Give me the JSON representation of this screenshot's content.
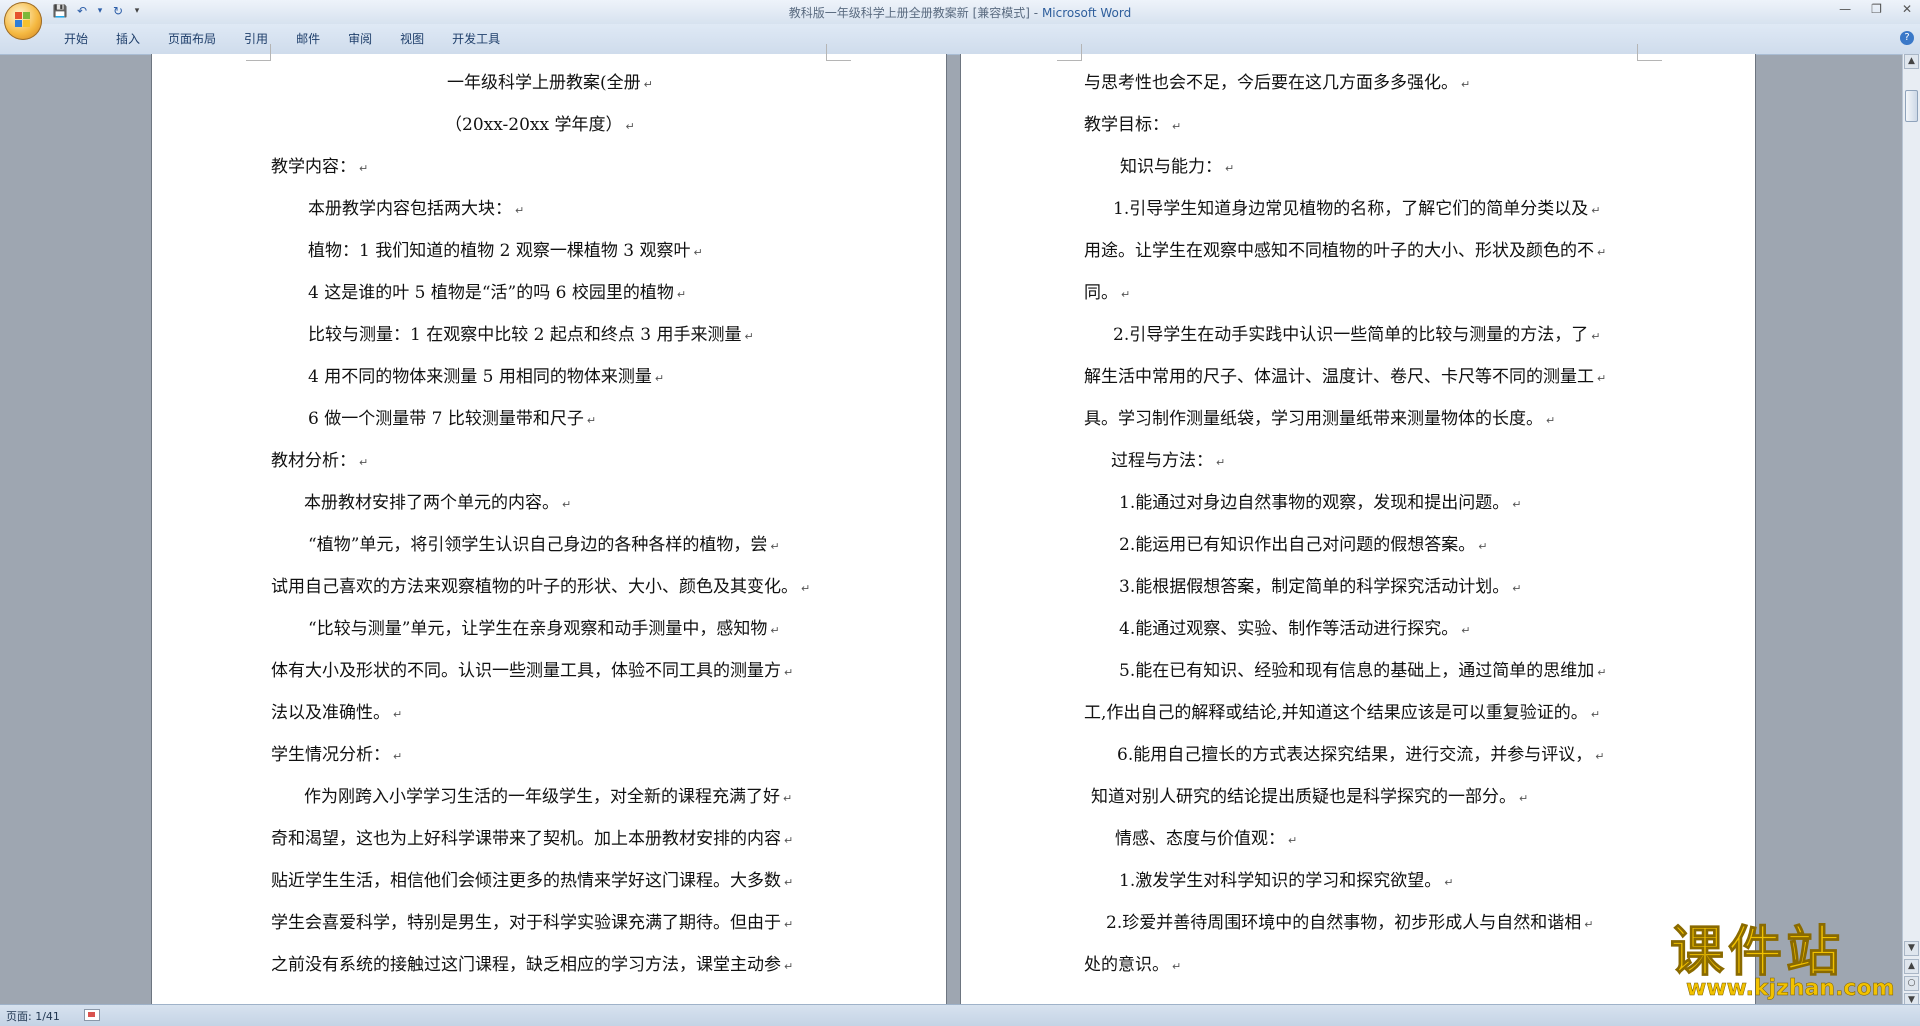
{
  "window": {
    "title_doc": "教科版一年级科学上册全册教案新 [兼容模式]",
    "title_sep": " - ",
    "title_app": "Microsoft Word",
    "help_glyph": "?"
  },
  "qat": {
    "save": "💾",
    "undo": "↶",
    "undo_dropdown": "▾",
    "redo": "↻",
    "customize": "▾"
  },
  "window_controls": {
    "minimize": "—",
    "restore": "❐",
    "close": "✕"
  },
  "ribbon": {
    "tabs": [
      "开始",
      "插入",
      "页面布局",
      "引用",
      "邮件",
      "审阅",
      "视图",
      "开发工具"
    ]
  },
  "page1": {
    "lines": [
      "一年级科学上册教案(全册",
      "（20xx-20xx 学年度）",
      "教学内容：",
      "本册教学内容包括两大块：",
      "植物：1 我们知道的植物   2 观察一棵植物   3 观察叶",
      "4 这是谁的叶   5 植物是“活”的吗   6 校园里的植物",
      "比较与测量：1 在观察中比较   2 起点和终点  3 用手来测量",
      "4 用不同的物体来测量   5 用相同的物体来测量",
      "6 做一个测量带           7 比较测量带和尺子",
      "教材分析：",
      "本册教材安排了两个单元的内容。",
      "“植物”单元，将引领学生认识自己身边的各种各样的植物，尝",
      "试用自己喜欢的方法来观察植物的叶子的形状、大小、颜色及其变化。",
      "“比较与测量”单元，让学生在亲身观察和动手测量中，感知物",
      "体有大小及形状的不同。认识一些测量工具，体验不同工具的测量方",
      "法以及准确性。",
      "学生情况分析：",
      "作为刚跨入小学学习生活的一年级学生，对全新的课程充满了好",
      "奇和渴望，这也为上好科学课带来了契机。加上本册教材安排的内容",
      "贴近学生生活，相信他们会倾注更多的热情来学好这门课程。大多数",
      "学生会喜爱科学，特别是男生，对于科学实验课充满了期待。但由于",
      "之前没有系统的接触过这门课程，缺乏相应的学习方法，课堂主动参"
    ]
  },
  "page2": {
    "lines": [
      "与思考性也会不足，今后要在这几方面多多强化。",
      "教学目标：",
      "知识与能力：",
      "1.引导学生知道身边常见植物的名称，了解它们的简单分类以及",
      "用途。让学生在观察中感知不同植物的叶子的大小、形状及颜色的不",
      "同。",
      "2.引导学生在动手实践中认识一些简单的比较与测量的方法，了",
      "解生活中常用的尺子、体温计、温度计、卷尺、卡尺等不同的测量工",
      "具。学习制作测量纸袋，学习用测量纸带来测量物体的长度。",
      "过程与方法：",
      "1.能通过对身边自然事物的观察，发现和提出问题。",
      "2.能运用已有知识作出自己对问题的假想答案。",
      "3.能根据假想答案，制定简单的科学探究活动计划。",
      "4.能通过观察、实验、制作等活动进行探究。",
      "5.能在已有知识、经验和现有信息的基础上，通过简单的思维加",
      "工,作出自己的解释或结论,并知道这个结果应该是可以重复验证的。",
      "6.能用自己擅长的方式表达探究结果，进行交流，并参与评议，",
      "知道对别人研究的结论提出质疑也是科学探究的一部分。",
      "情感、态度与价值观：",
      "1.激发学生对科学知识的学习和探究欲望。",
      "2.珍爱并善待周围环境中的自然事物，初步形成人与自然和谐相",
      "处的意识。"
    ]
  },
  "paragraph_mark": "↵",
  "scrollbar": {
    "up": "▲",
    "down": "▼",
    "prev_page": "▲",
    "next_page": "▼",
    "select_browse": "○"
  },
  "statusbar": {
    "page_info": "页面: 1/41"
  },
  "watermark": {
    "text": "课件站",
    "url": "www.kjzhan.com"
  }
}
